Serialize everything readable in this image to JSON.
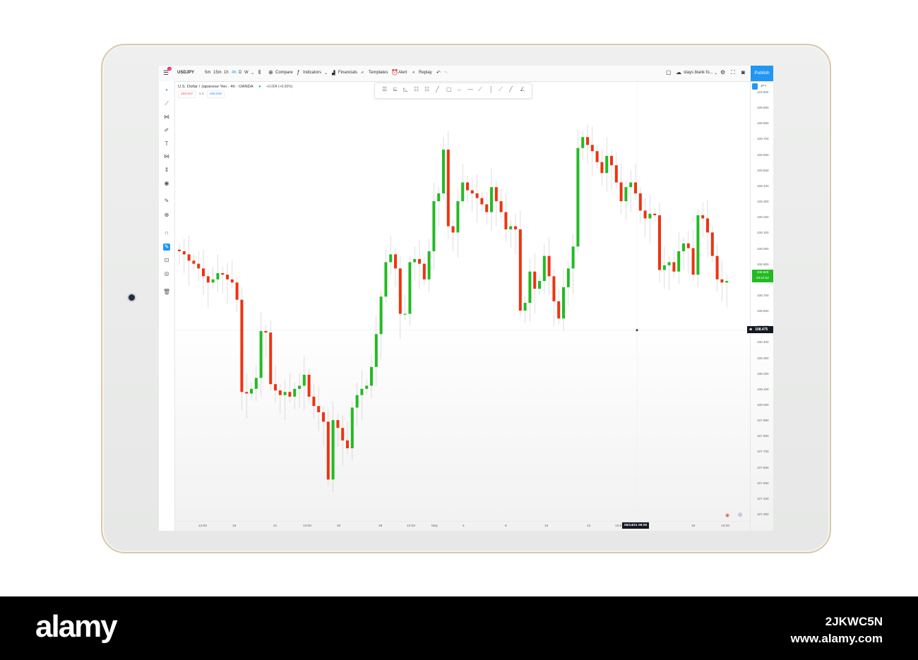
{
  "toolbar": {
    "badge": "10",
    "symbol": "USDJPY",
    "intervals": [
      "5m",
      "15m",
      "1h",
      "4h",
      "D",
      "W"
    ],
    "active_interval": "4h",
    "compare": "Compare",
    "indicators": "Indicators",
    "financials": "Financials",
    "templates": "Templates",
    "alert": "Alert",
    "replay": "Replay",
    "layout_name": "stays blank fo...",
    "publish": "Publish"
  },
  "legend": {
    "title": "U.S. Dollar / Japanese Yen · 4h · OANDA",
    "change": "+0.004 (+0.00%)",
    "bid": "108.837",
    "spread": "1.4",
    "ask": "108.849"
  },
  "price_axis": {
    "currency": "JPY",
    "labels": [
      "110.000",
      "109.900",
      "109.800",
      "109.700",
      "109.600",
      "109.500",
      "109.400",
      "109.300",
      "109.200",
      "109.100",
      "109.000",
      "108.900",
      "108.800",
      "108.700",
      "108.600",
      "108.500",
      "108.400",
      "108.300",
      "108.200",
      "108.100",
      "108.000",
      "107.900",
      "107.800",
      "107.700",
      "107.600",
      "107.500",
      "107.400",
      "107.300"
    ],
    "current_price": "108.829",
    "countdown": "03:22:52",
    "crosshair_price": "108.475"
  },
  "time_axis": {
    "labels": [
      "13:00",
      "19",
      "21",
      "13:00",
      "26",
      "28",
      "13:00",
      "May",
      "4",
      "6",
      "10",
      "12",
      "13:0",
      "19",
      "13:00"
    ],
    "crosshair_time": "05/14/21  09:00"
  },
  "colors": {
    "up": "#22bb22",
    "down": "#ee3311",
    "accent": "#2196f3"
  },
  "chart_data": {
    "type": "candlestick",
    "symbol": "USDJPY",
    "interval": "4h",
    "ylim": [
      107.25,
      110.02
    ],
    "wick": 0.04,
    "first_open": 108.99,
    "closes": [
      108.98,
      108.96,
      108.92,
      108.9,
      108.87,
      108.82,
      108.78,
      108.8,
      108.84,
      108.83,
      108.8,
      108.78,
      108.67,
      108.08,
      108.07,
      108.1,
      108.17,
      108.47,
      108.46,
      108.13,
      108.09,
      108.06,
      108.08,
      108.05,
      108.1,
      108.12,
      108.19,
      108.05,
      107.99,
      107.95,
      107.89,
      107.52,
      107.9,
      107.85,
      107.77,
      107.72,
      107.98,
      108.06,
      108.1,
      108.12,
      108.24,
      108.45,
      108.69,
      108.91,
      108.96,
      108.87,
      108.58,
      108.58,
      108.91,
      108.93,
      108.9,
      108.8,
      108.98,
      109.3,
      109.35,
      109.63,
      109.14,
      109.1,
      109.3,
      109.42,
      109.37,
      109.35,
      109.32,
      109.28,
      109.23,
      109.39,
      109.3,
      109.23,
      109.12,
      109.14,
      109.12,
      108.6,
      108.65,
      108.85,
      108.74,
      108.79,
      108.95,
      108.82,
      108.66,
      108.55,
      108.75,
      108.87,
      109.01,
      109.64,
      109.71,
      109.66,
      109.62,
      109.55,
      109.48,
      109.59,
      109.53,
      109.42,
      109.3,
      109.39,
      109.42,
      109.35,
      109.24,
      109.19,
      109.22,
      109.21,
      108.86,
      108.89,
      108.91,
      108.85,
      108.98,
      109.03,
      109.0,
      108.83,
      109.21,
      109.19,
      109.1,
      108.95,
      108.8,
      108.78,
      108.79
    ]
  },
  "footer": {
    "logo": "alamy",
    "image_id": "2JKWC5N",
    "url": "www.alamy.com"
  }
}
